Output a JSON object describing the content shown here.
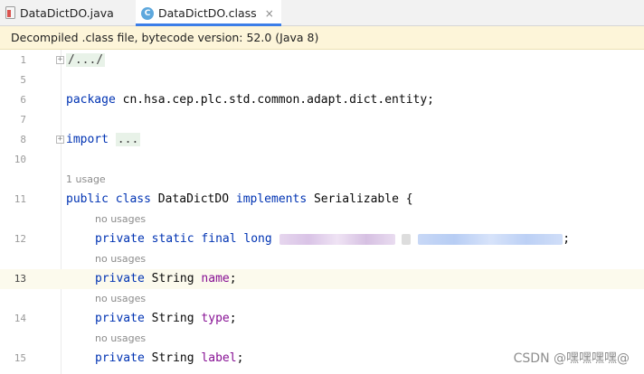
{
  "tabs": [
    {
      "label": "DataDictDO.java",
      "icon": "java-file-icon",
      "active": false
    },
    {
      "label": "DataDictDO.class",
      "icon": "class-file-icon",
      "active": true,
      "close": "×"
    }
  ],
  "banner": {
    "text": "Decompiled .class file, bytecode version: 52.0 (Java 8)"
  },
  "lines": [
    {
      "num": "1",
      "fold": "+",
      "text": "/.../"
    },
    {
      "num": "5",
      "text": ""
    },
    {
      "num": "6",
      "kw": "package",
      "rest": " cn.hsa.cep.plc.std.common.adapt.dict.entity;"
    },
    {
      "num": "7",
      "text": ""
    },
    {
      "num": "8",
      "fold": "+",
      "kw": "import",
      "fold_text": "..."
    },
    {
      "num": "10",
      "text": ""
    },
    {
      "hint": "1 usage"
    },
    {
      "num": "11",
      "kw1": "public",
      "kw2": "class",
      "name": "DataDictDO",
      "kw3": "implements",
      "iface": "Serializable",
      "brace": "{"
    },
    {
      "hint": "no usages"
    },
    {
      "num": "12",
      "kw1": "private",
      "kw2": "static",
      "kw3": "final",
      "kw4": "long",
      "end": ";"
    },
    {
      "hint": "no usages"
    },
    {
      "num": "13",
      "kw": "private",
      "type": "String",
      "field": "name",
      "end": ";",
      "current": true
    },
    {
      "hint": "no usages"
    },
    {
      "num": "14",
      "kw": "private",
      "type": "String",
      "field": "type",
      "end": ";"
    },
    {
      "hint": "no usages"
    },
    {
      "num": "15",
      "kw": "private",
      "type": "String",
      "field": "label",
      "end": ";"
    }
  ],
  "watermark": "CSDN @嘿嘿嘿嘿@",
  "colors": {
    "keyword": "#0033b3",
    "field": "#871094",
    "banner_bg": "#fdf5d9",
    "tab_underline": "#3c7ee8"
  }
}
